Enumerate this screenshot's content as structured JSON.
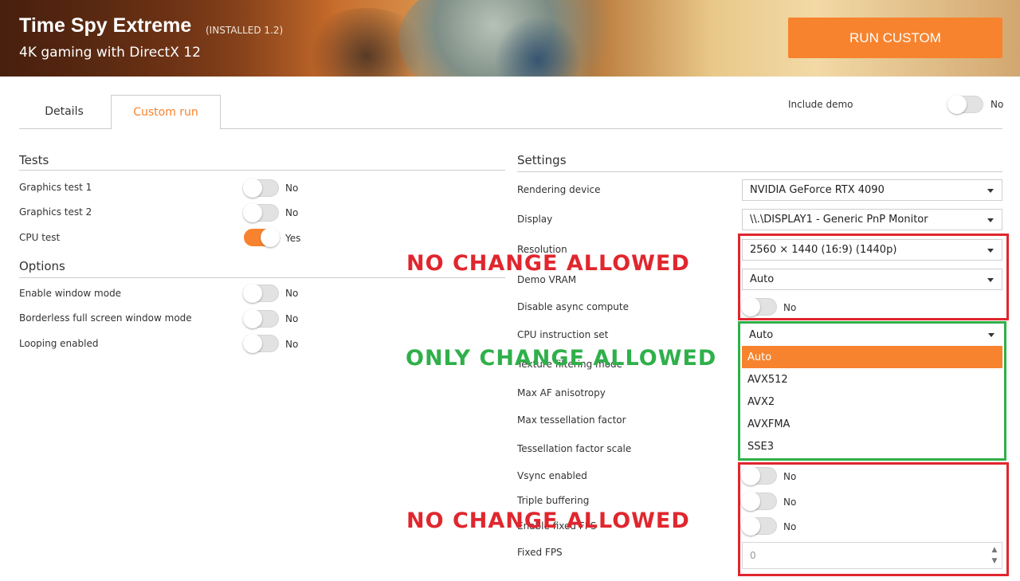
{
  "header": {
    "title": "Time Spy Extreme",
    "installed": "(INSTALLED 1.2)",
    "subtitle": "4K gaming with DirectX 12",
    "run_button": "RUN CUSTOM"
  },
  "tabs": [
    {
      "label": "Details",
      "active": false
    },
    {
      "label": "Custom run",
      "active": true
    }
  ],
  "include_demo": {
    "label": "Include demo",
    "value": "No"
  },
  "tests": {
    "heading": "Tests",
    "items": [
      {
        "label": "Graphics test 1",
        "value": "No"
      },
      {
        "label": "Graphics test 2",
        "value": "No"
      },
      {
        "label": "CPU test",
        "value": "Yes"
      }
    ]
  },
  "options": {
    "heading": "Options",
    "items": [
      {
        "label": "Enable window mode",
        "value": "No"
      },
      {
        "label": "Borderless full screen window mode",
        "value": "No"
      },
      {
        "label": "Looping enabled",
        "value": "No"
      }
    ]
  },
  "settings": {
    "heading": "Settings",
    "rendering_device": {
      "label": "Rendering device",
      "value": "NVIDIA GeForce RTX 4090"
    },
    "display": {
      "label": "Display",
      "value": "\\\\.\\DISPLAY1 - Generic PnP Monitor"
    },
    "resolution": {
      "label": "Resolution",
      "value": "2560 × 1440 (16:9) (1440p)"
    },
    "demo_vram": {
      "label": "Demo VRAM",
      "value": "Auto"
    },
    "disable_async": {
      "label": "Disable async compute",
      "value": "No"
    },
    "cpu_instruction": {
      "label": "CPU instruction set",
      "value": "Auto",
      "options": [
        "Auto",
        "AVX512",
        "AVX2",
        "AVXFMA",
        "SSE3"
      ]
    },
    "texture_filtering": {
      "label": "Texture filtering mode"
    },
    "max_af": {
      "label": "Max AF anisotropy"
    },
    "max_tess": {
      "label": "Max tessellation factor"
    },
    "tess_scale": {
      "label": "Tessellation factor scale"
    },
    "vsync": {
      "label": "Vsync enabled",
      "value": "No"
    },
    "triple_buffering": {
      "label": "Triple buffering",
      "value": "No"
    },
    "enable_fixed_fps": {
      "label": "Enable fixed FPS",
      "value": "No"
    },
    "fixed_fps": {
      "label": "Fixed FPS",
      "value": "0"
    }
  },
  "annotations": {
    "no_change_1": "NO CHANGE ALLOWED",
    "only_change": "ONLY CHANGE ALLOWED",
    "no_change_2": "NO CHANGE ALLOWED"
  },
  "colors": {
    "accent": "#f7832e",
    "annotation_red": "#e0262e",
    "annotation_green": "#2fb04a"
  }
}
